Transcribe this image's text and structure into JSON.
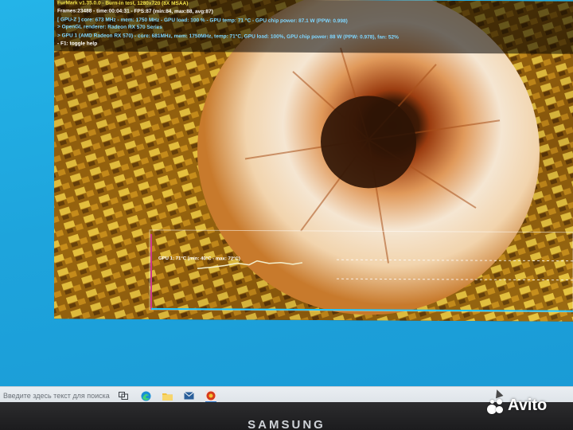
{
  "furmark": {
    "title": "FurMark v1.35.0.0 - Burn-in test, 1280x720 (8X MSAA)",
    "stats": "Frames:23488 - time:00:04:31 - FPS:87 (min:84, max:88, avg:87)",
    "gpuz": "[ GPU-Z ] core: 673 MHz - mem: 1750 MHz - GPU load: 100 % - GPU temp: 71 °C - GPU chip power: 87.1 W (PPW: 0.998)",
    "renderer": "> OpenGL renderer: Radeon RX 570 Series",
    "gpu1": "> GPU 1 (AMD Radeon RX 570) - core: 681MHz, mem: 1750MHz, temp: 71°C, GPU load: 100%, GPU chip power: 88 W (PPW: 0.978), fan: 52%",
    "help": "- F1: toggle help",
    "graph_label": "GPU 1: 71°C (min: 40°C - max: 72°C)"
  },
  "taskbar": {
    "search_placeholder": "Введите здесь текст для поиска"
  },
  "monitor": {
    "brand": "SAMSUNG"
  },
  "watermark": {
    "text": "Avito"
  },
  "colors": {
    "desktop": "#1ea4dc",
    "osd_title": "#f2e34a",
    "osd_info": "#7fd6ff"
  }
}
